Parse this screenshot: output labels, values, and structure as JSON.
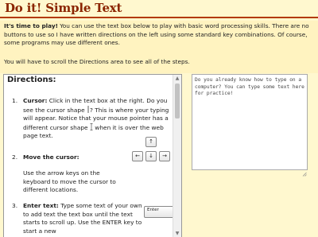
{
  "page": {
    "title": "Do it! Simple Text"
  },
  "intro": {
    "lead": "It's time to play!",
    "p1_rest": " You can use the text box below to play with basic word processing skills. There are no buttons to use so I have written directions on the left using some standard key combinations. Of course, some programs may use different ones.",
    "p2": "You will have to scroll the Directions area to see all of the steps."
  },
  "directions": {
    "title": "Directions:",
    "steps": [
      {
        "num": "1.",
        "label": "Cursor:",
        "text_a": " Click in the text box at the right. Do you see the cursor shape",
        "text_b": "? This is where your typing will appear. Notice that your mouse pointer has a different cursor shape",
        "text_c": " when it is over the web page text."
      },
      {
        "num": "2.",
        "label": "Move the cursor:",
        "text": "Use the arrow keys on the keyboard to move the cursor to different locations."
      },
      {
        "num": "3.",
        "label": "Enter text:",
        "text": " Type some text of your own to add text the text box until the text starts to scroll up. Use the ENTER key to start a new"
      }
    ],
    "arrow_keys": [
      "↑",
      "←",
      "↓",
      "→"
    ],
    "enter_key": "Enter"
  },
  "practice_box": {
    "value": "Do you already know how to type on a computer? You can type some text here for practice!"
  },
  "icons": {
    "cursor": "text-cursor-icon",
    "ibeam": "ibeam-pointer-icon",
    "scroll_up": "scroll-up-arrow-icon",
    "scroll_down": "scroll-down-arrow-icon",
    "resize": "resize-grip-icon"
  },
  "colors": {
    "title": "#8b2500",
    "title_rule": "#b33a00",
    "background": "#fff8cf",
    "intro_band": "#fff3c0"
  }
}
